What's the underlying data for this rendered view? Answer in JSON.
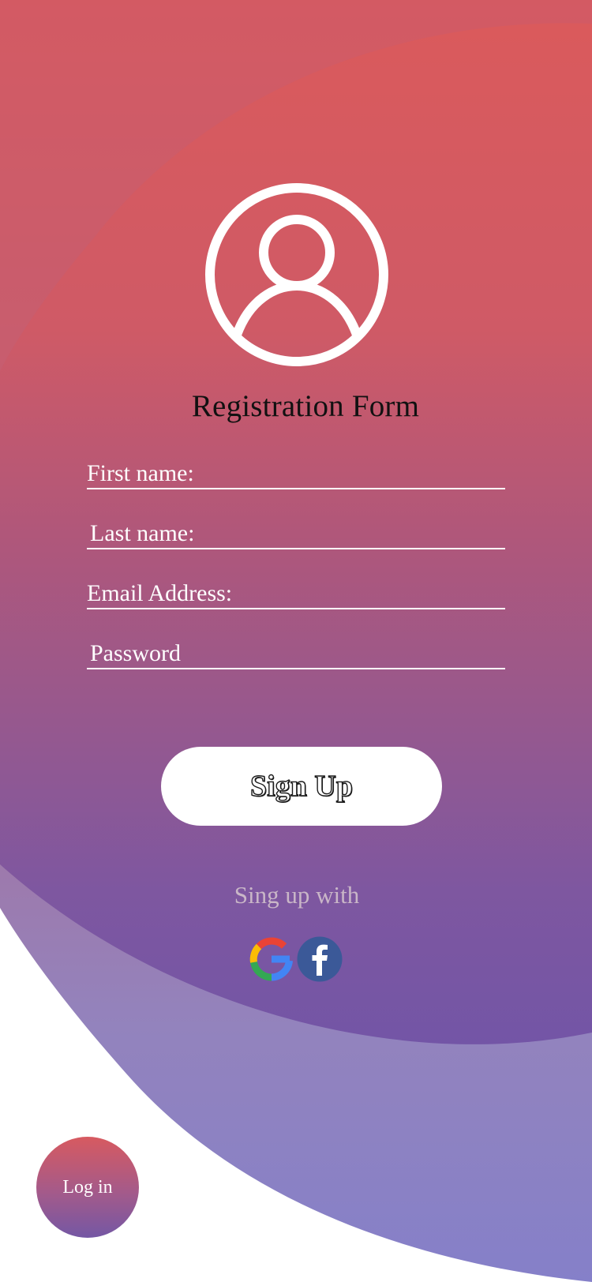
{
  "header": {
    "icon": "user-circle-icon",
    "title": "Registration Form"
  },
  "form": {
    "first_name_placeholder": "First name:",
    "last_name_placeholder": "Last name:",
    "email_placeholder": "Email Address:",
    "password_placeholder": "Password"
  },
  "signup": {
    "button_label": "Sign Up"
  },
  "social": {
    "label": "Sing up with",
    "providers": [
      "google-icon",
      "facebook-icon"
    ]
  },
  "login": {
    "button_label": "Log in"
  },
  "colors": {
    "gradient_top": "#d75a5e",
    "gradient_mid": "#a4577f",
    "gradient_bottom": "#7455a5",
    "outer_wave_top": "#c4607c",
    "outer_wave_bottom": "#8480c9",
    "button_bg": "#ffffff",
    "text_light": "#ffffff"
  }
}
